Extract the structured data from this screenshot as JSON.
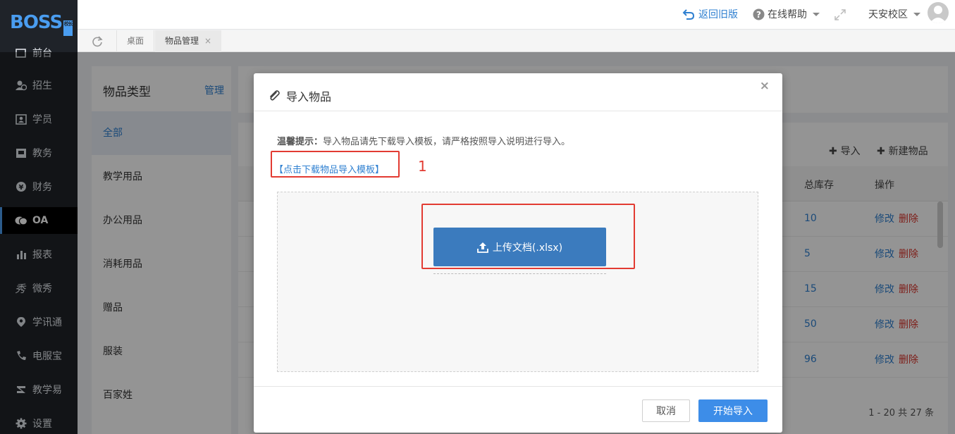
{
  "app": {
    "logo_text": "BOSS",
    "logo_badge": "校长"
  },
  "sidebar": {
    "items": [
      {
        "label": "前台",
        "icon": "desk-icon"
      },
      {
        "label": "招生",
        "icon": "user-add-icon"
      },
      {
        "label": "学员",
        "icon": "id-card-icon"
      },
      {
        "label": "教务",
        "icon": "book-icon"
      },
      {
        "label": "财务",
        "icon": "yen-icon"
      },
      {
        "label": "OA",
        "icon": "chat-icon",
        "active": true
      },
      {
        "label": "报表",
        "icon": "bar-chart-icon"
      },
      {
        "label": "微秀",
        "icon": "show-icon"
      },
      {
        "label": "学讯通",
        "icon": "location-icon"
      },
      {
        "label": "电服宝",
        "icon": "phone-icon"
      },
      {
        "label": "教学易",
        "icon": "teach-icon"
      },
      {
        "label": "设置",
        "icon": "gear-icon"
      }
    ]
  },
  "topbar": {
    "back_label": "返回旧版",
    "help_label": "在线帮助",
    "campus_label": "天安校区"
  },
  "tabs": {
    "desk": "桌面",
    "goods": "物品管理"
  },
  "left_panel": {
    "title": "物品类型",
    "manage": "管理",
    "categories": [
      "全部",
      "教学用品",
      "办公用品",
      "消耗用品",
      "赠品",
      "服装",
      "百家姓"
    ]
  },
  "right_panel": {
    "import_label": "导入",
    "new_label": "新建物品",
    "columns": {
      "stock": "总库存",
      "action": "操作"
    },
    "rows": [
      {
        "stock": "10",
        "edit": "修改",
        "delete": "删除"
      },
      {
        "stock": "5",
        "edit": "修改",
        "delete": "删除"
      },
      {
        "stock": "15",
        "edit": "修改",
        "delete": "删除"
      },
      {
        "stock": "50",
        "edit": "修改",
        "delete": "删除"
      },
      {
        "stock": "96",
        "edit": "修改",
        "delete": "删除"
      }
    ],
    "pager": "1 - 20   共 27 条"
  },
  "modal": {
    "title": "导入物品",
    "close": "×",
    "tip_label": "温馨提示：",
    "tip_text": "导入物品请先下载导入模板，请严格按照导入说明进行导入。",
    "download_link": "【点击下载物品导入模板】",
    "annotation_number": "1",
    "upload_label": "上传文档(.xlsx)",
    "cancel_label": "取消",
    "start_label": "开始导入"
  },
  "colors": {
    "accent": "#2f80d1",
    "annotation_red": "#e23b32",
    "sidebar_bg": "#1f2329"
  }
}
